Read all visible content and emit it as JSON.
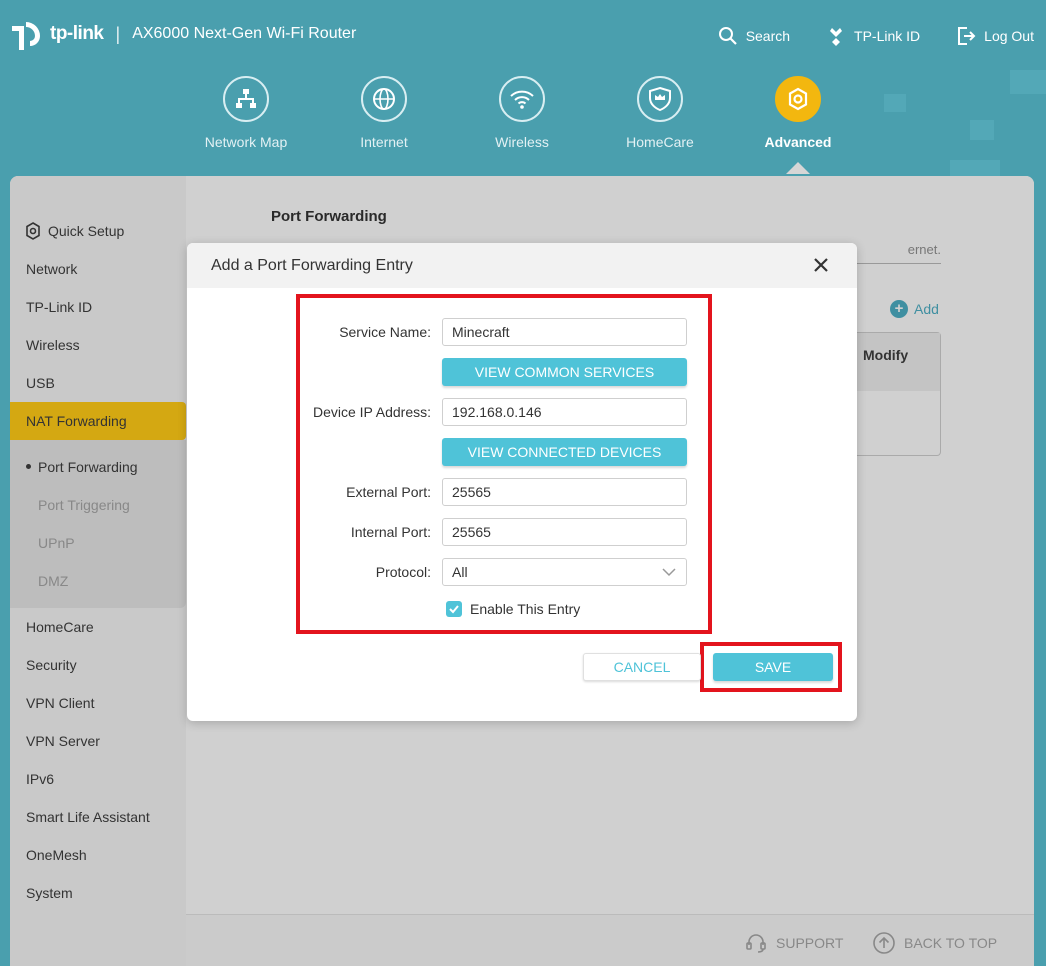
{
  "header": {
    "brand": "tp-link",
    "separator": "|",
    "model": "AX6000 Next-Gen Wi-Fi Router",
    "links": [
      {
        "label": "Search",
        "icon": "search-icon"
      },
      {
        "label": "TP-Link ID",
        "icon": "tplink-id-icon"
      },
      {
        "label": "Log Out",
        "icon": "logout-icon"
      }
    ]
  },
  "nav": [
    {
      "label": "Network Map",
      "icon": "network-map-icon"
    },
    {
      "label": "Internet",
      "icon": "globe-icon"
    },
    {
      "label": "Wireless",
      "icon": "wifi-icon"
    },
    {
      "label": "HomeCare",
      "icon": "shield-icon"
    },
    {
      "label": "Advanced",
      "icon": "gear-icon",
      "active": true
    }
  ],
  "sidebar": {
    "items": [
      {
        "label": "Quick Setup",
        "icon": "quick-setup-icon"
      },
      {
        "label": "Network"
      },
      {
        "label": "TP-Link ID"
      },
      {
        "label": "Wireless"
      },
      {
        "label": "USB"
      },
      {
        "label": "NAT Forwarding",
        "active": true
      },
      {
        "label": "HomeCare"
      },
      {
        "label": "Security"
      },
      {
        "label": "VPN Client"
      },
      {
        "label": "VPN Server"
      },
      {
        "label": "IPv6"
      },
      {
        "label": "Smart Life Assistant"
      },
      {
        "label": "OneMesh"
      },
      {
        "label": "System"
      }
    ],
    "sub_items": [
      {
        "label": "Port Forwarding",
        "current": true
      },
      {
        "label": "Port Triggering"
      },
      {
        "label": "UPnP"
      },
      {
        "label": "DMZ"
      }
    ]
  },
  "main": {
    "title": "Port Forwarding",
    "description_fragment": "ernet.",
    "add_label": "Add",
    "table_header_modify": "Modify"
  },
  "modal": {
    "title": "Add a Port Forwarding Entry",
    "fields": {
      "service_name_label": "Service Name:",
      "service_name_value": "Minecraft",
      "view_common_services": "VIEW COMMON SERVICES",
      "device_ip_label": "Device IP Address:",
      "device_ip_value": "192.168.0.146",
      "view_connected_devices": "VIEW CONNECTED DEVICES",
      "external_port_label": "External Port:",
      "external_port_value": "25565",
      "internal_port_label": "Internal Port:",
      "internal_port_value": "25565",
      "protocol_label": "Protocol:",
      "protocol_value": "All",
      "enable_label": "Enable This Entry",
      "enable_checked": true
    },
    "cancel_label": "CANCEL",
    "save_label": "SAVE"
  },
  "footer": {
    "support_label": "SUPPORT",
    "back_to_top_label": "BACK TO TOP"
  },
  "colors": {
    "header_teal": "#4a9fae",
    "accent_cyan": "#4fc3d8",
    "active_yellow": "#f3b70f",
    "highlight_red": "#e3141d"
  }
}
